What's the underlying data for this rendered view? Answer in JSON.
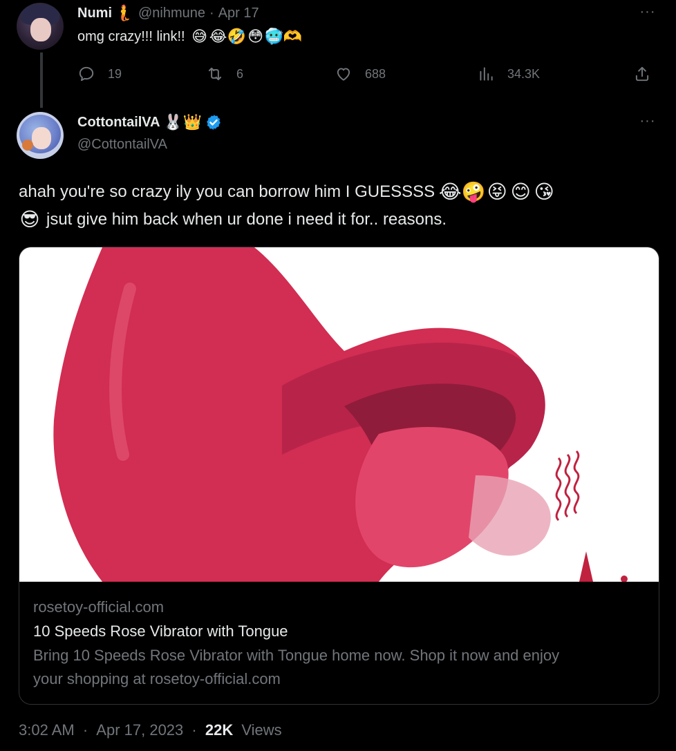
{
  "reply": {
    "display_name": "Numi",
    "name_emoji": "🧜",
    "handle": "@nihmune",
    "separator": "·",
    "date": "Apr 17",
    "text": "omg crazy!!! link!!",
    "text_emojis": [
      "😅",
      "😂",
      "🤣",
      "😳",
      "🥶",
      "🫶"
    ],
    "more": "···",
    "actions": {
      "replies": "19",
      "retweets": "6",
      "likes": "688",
      "views": "34.3K"
    }
  },
  "tweet": {
    "display_name": "CottontailVA",
    "name_badges": [
      "🐰",
      "👑"
    ],
    "handle": "@CottontailVA",
    "more": "···",
    "body_line1": "ahah you're so crazy ily you can borrow him I GUESSSS",
    "body_line1_emojis": [
      "😂",
      "🤪",
      "😝",
      "😊",
      "😘"
    ],
    "body_line2_emoji": "😎",
    "body_line2": "jsut give him back when ur done i need it for.. reasons.",
    "colors": {
      "verified": "#1d9bf0",
      "product": "#d22d52"
    }
  },
  "card": {
    "domain": "rosetoy-official.com",
    "title": "10 Speeds Rose Vibrator with Tongue",
    "description_line1": "Bring 10 Speeds Rose Vibrator with Tongue home now. Shop it now and enjoy",
    "description_line2": "your shopping at rosetoy-official.com"
  },
  "meta": {
    "time": "3:02 AM",
    "separator": "·",
    "date": "Apr 17, 2023",
    "separator2": "·",
    "views_count": "22K",
    "views_label": "Views"
  }
}
